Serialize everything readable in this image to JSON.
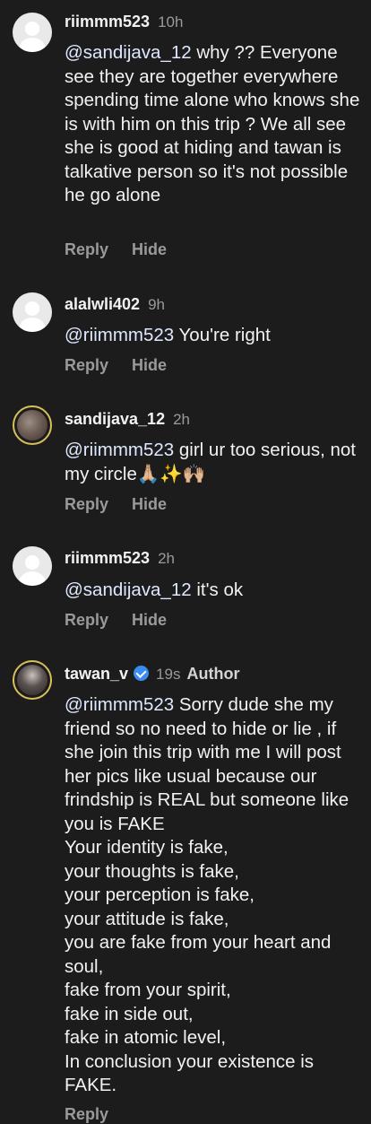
{
  "comments": [
    {
      "username": "riimmm523",
      "time": "10h",
      "mention": "@sandijava_12",
      "text": " why ?? Everyone see they are together everywhere spending time alone who knows she is with him on this trip ? We all see she is good at hiding and tawan is talkative person so it's not possible he go alone",
      "reply_label": "Reply",
      "hide_label": "Hide"
    },
    {
      "username": "alalwli402",
      "time": "9h",
      "mention": "@riimmm523",
      "text": " You're right",
      "reply_label": "Reply",
      "hide_label": "Hide"
    },
    {
      "username": "sandijava_12",
      "time": "2h",
      "mention": "@riimmm523",
      "text": " girl ur too serious, not my circle🙏🏼✨🙌🏼",
      "reply_label": "Reply",
      "hide_label": "Hide"
    },
    {
      "username": "riimmm523",
      "time": "2h",
      "mention": "@sandijava_12",
      "text": " it's ok",
      "reply_label": "Reply",
      "hide_label": "Hide"
    },
    {
      "username": "tawan_v",
      "verified_icon": "verified-badge-icon",
      "time": "19s",
      "author_label": "Author",
      "mention": "@riimmm523",
      "text": " Sorry dude she my friend so no need to hide or lie , if she join this trip with me I will post her pics like usual because our frindship is REAL but someone like you is FAKE\nYour identity is fake,\nyour thoughts is fake,\nyour perception is fake,\nyour attitude is fake,\nyou are fake from your heart and soul,\nfake from your spirit,\nfake in side out,\nfake in atomic level,\nIn conclusion your existence is FAKE.",
      "reply_label": "Reply"
    }
  ],
  "colors": {
    "background": "#1c1c1c",
    "text": "#f2f2f2",
    "muted": "#9a9a9a",
    "verified": "#3a8bf2"
  }
}
